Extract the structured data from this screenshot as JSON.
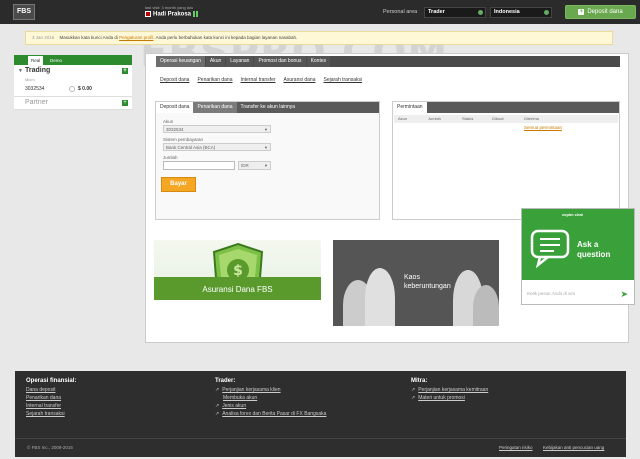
{
  "topbar": {
    "logo": "FBS",
    "user_subtitle": "last visit: 3 month yang lalu",
    "user_name": "Hadi Prakosa",
    "personal_area_label": "Personal area",
    "mode_select": "Trader",
    "language_select": "Indonesia",
    "deposit_button": "Deposit dana"
  },
  "watermark": "FBSPRO.COM",
  "notice": {
    "date": "3 Jan 2016",
    "text_before": "Masukkan kata kunci Anda di",
    "link": "Pengaturan profil",
    "text_after": ". Anda perlu berbahukan kata kunci ini kepada bagian layanan nasabah."
  },
  "sidebar": {
    "tabs": [
      "Real",
      "Demo"
    ],
    "trading_title": "Trading",
    "account_label": "Micro",
    "account_number": "3032534",
    "account_balance": "$ 0.00",
    "partner_title": "Partner"
  },
  "main": {
    "tabs": [
      "Operasi keuangan",
      "Akun",
      "Layanan",
      "Promosi dan bonus",
      "Kontes"
    ],
    "sub_tabs": [
      "Deposit dana",
      "Penarikan dana",
      "Internal transfer",
      "Asuransi dana",
      "Sejarah transaksi"
    ]
  },
  "deposit_box": {
    "tabs": [
      "Deposit dana",
      "Penarikan dana",
      "Transfer ke akun lainnya"
    ],
    "account_label": "Akun",
    "account_value": "3032534",
    "payment_label": "Sistem pembayaran",
    "payment_value": "Bank Central Asia (BCA)",
    "amount_label": "Jumlah",
    "currency_value": "IDR",
    "pay_button": "Bayar"
  },
  "requests_box": {
    "tab": "Permintaan",
    "columns": [
      "Akun",
      "Jumlah",
      "Status",
      "Dibuat",
      "Diterima"
    ],
    "link": "Semua permintaan"
  },
  "banners": {
    "insurance_text": "Asuransi Dana FBS",
    "kaos_line1": "Kaos",
    "kaos_line2": "keberuntungan"
  },
  "chat": {
    "brand": "zopim chat",
    "ask_line1": "Ask a",
    "ask_line2": "question",
    "input_placeholder": "Ketik pesan Anda di sini"
  },
  "footer": {
    "col1_title": "Operasi finansial:",
    "col1_links": [
      "Dana deposit",
      "Penarikan dana",
      "Internal transfer",
      "Sejarah transaksi"
    ],
    "col2_title": "Trader:",
    "col2_links": [
      "Perjanjian kerjasama klien",
      "Membuka akun",
      "Jenis akun",
      "Analisa forex dan Berita Pasar di FX Bangsaka"
    ],
    "col3_title": "Mitra:",
    "col3_links": [
      "Perjanjian kerjasama kemitraan",
      "Materi untuk promosi"
    ],
    "copyright": "© FBS Inc., 2009-2016",
    "legal_links": [
      "Peringatan risiko",
      "Kebijakan anti pencucian uang"
    ]
  }
}
